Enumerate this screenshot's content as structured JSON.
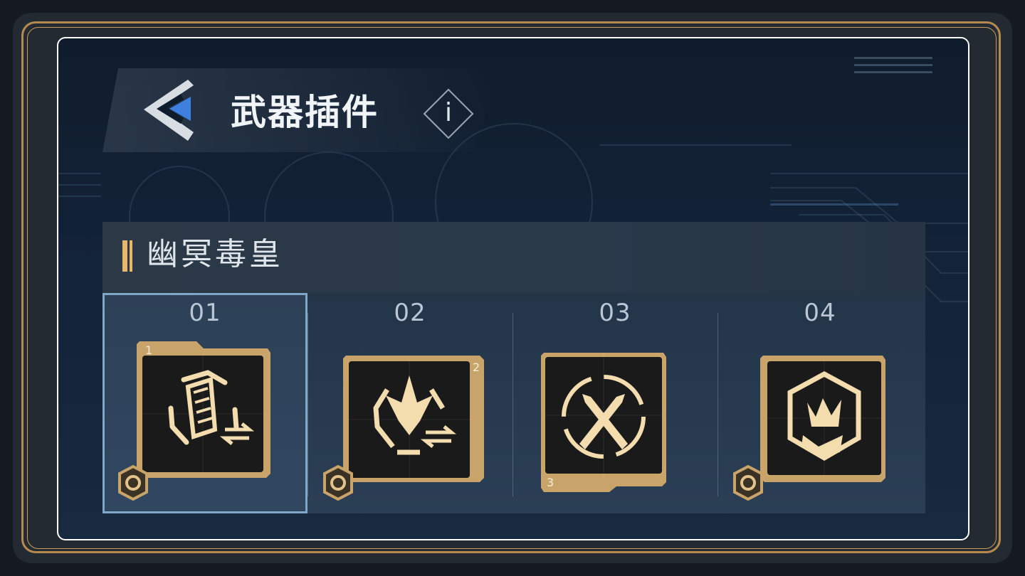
{
  "header": {
    "title": "武器插件",
    "info_label": "i"
  },
  "weapon": {
    "name": "幽冥毒皇"
  },
  "slots": [
    {
      "number": "01",
      "plugin_icon": "magazine-reload-icon",
      "rank": "1",
      "selected": true,
      "has_gear": true
    },
    {
      "number": "02",
      "plugin_icon": "burst-reload-icon",
      "rank": "2",
      "selected": false,
      "has_gear": true
    },
    {
      "number": "03",
      "plugin_icon": "crossed-bullets-icon",
      "rank": "3",
      "selected": false,
      "has_gear": false
    },
    {
      "number": "04",
      "plugin_icon": "toxic-fist-icon",
      "rank": "",
      "selected": false,
      "has_gear": true
    }
  ],
  "colors": {
    "gold": "#e8c98c",
    "gold_dark": "#b58a4f",
    "card_bg": "#1b1a1a",
    "selected_outline": "#7fa7c7",
    "back_arrow_blue": "#3f7fe0"
  }
}
